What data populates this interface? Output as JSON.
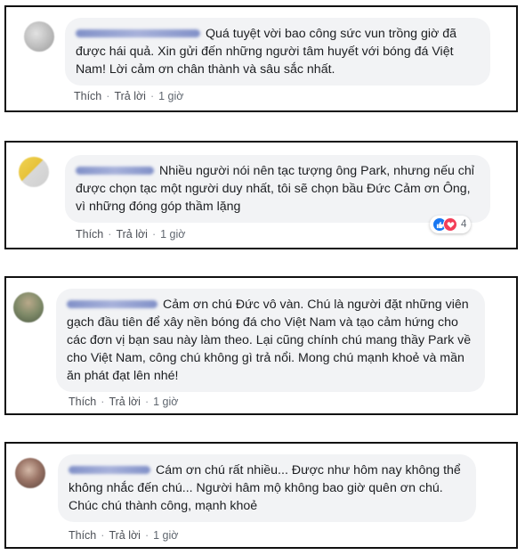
{
  "comments": [
    {
      "text": "Quá tuyệt vời bao công sức vun trồng giờ đã được hái quả. Xin gửi đến những người tâm huyết với bóng đá Việt Nam! Lời cảm ơn chân thành và sâu sắc nhất.",
      "like": "Thích",
      "reply": "Trả lời",
      "time": "1 giờ",
      "avatar_color": "#c9c9c9"
    },
    {
      "text": "Nhiều người nói nên tạc tượng ông Park, nhưng nếu chỉ được chọn tạc một người duy nhất, tôi sẽ chọn bầu Đức Cảm ơn Ông, vì những đóng góp thầm lặng",
      "like": "Thích",
      "reply": "Trả lời",
      "time": "1 giờ",
      "reaction_count": "4",
      "reaction_icons": [
        "like-icon",
        "love-icon"
      ],
      "avatar_color": "#e8c74a"
    },
    {
      "text": "Cảm ơn chú Đức vô vàn. Chú là người đặt những viên gạch đầu tiên để xây nền bóng đá cho Việt Nam và tạo cảm hứng cho các đơn vị bạn sau này làm theo. Lại cũng chính chú mang thầy Park về cho Việt Nam, công chú không gì trả nổi. Mong chú mạnh khoẻ và mần ăn phát đạt lên nhé!",
      "like": "Thích",
      "reply": "Trả lời",
      "time": "1 giờ",
      "avatar_color": "#7a8a6a"
    },
    {
      "text": "Cám ơn chú rất nhiều... Được như hôm nay không thể không nhắc đến chú... Người hâm mộ không bao giờ quên ơn chú. Chúc chú thành công, mạnh khoẻ",
      "like": "Thích",
      "reply": "Trả lời",
      "time": "1 giờ",
      "avatar_color": "#8a6a5a"
    }
  ],
  "colors": {
    "bubble": "#f2f3f5",
    "action_text": "#4b4f56",
    "like_blue": "#1877f2",
    "love_red": "#f33e58",
    "name_blur": "#5b6fb3"
  }
}
